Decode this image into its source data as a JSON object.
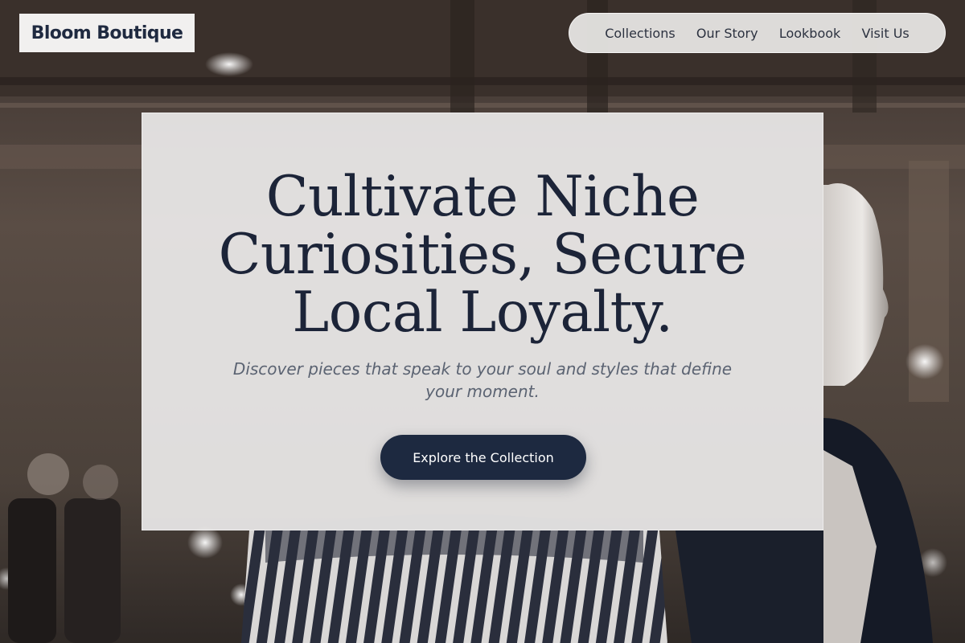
{
  "brand": {
    "name": "Bloom Boutique"
  },
  "nav": {
    "items": [
      {
        "label": "Collections"
      },
      {
        "label": "Our Story"
      },
      {
        "label": "Lookbook"
      },
      {
        "label": "Visit Us"
      }
    ]
  },
  "hero": {
    "headline": "Cultivate Niche Curiosities, Secure Local Loyalty.",
    "subheadline": "Discover pieces that speak to your soul and styles that define your moment.",
    "cta_label": "Explore the Collection"
  },
  "colors": {
    "navy": "#1d2940",
    "panel": "#efeeee",
    "text_dark": "#1c2438",
    "text_muted": "#5b6372"
  },
  "background": {
    "icon": "boutique-store-photo"
  }
}
